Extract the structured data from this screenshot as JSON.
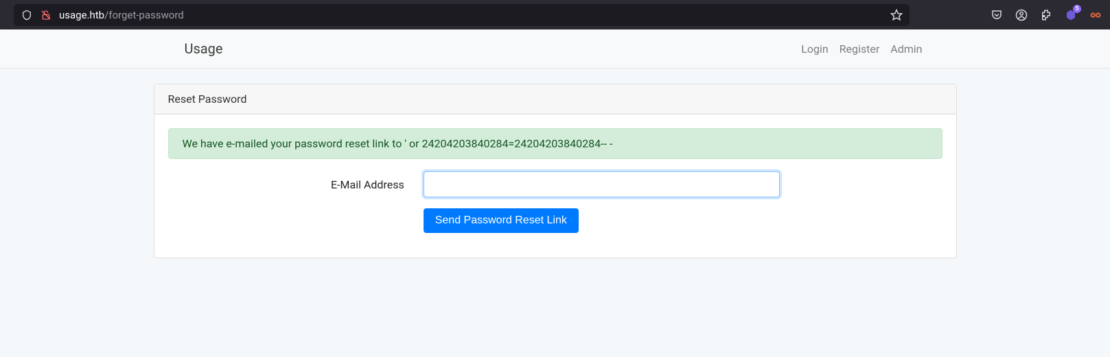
{
  "browser": {
    "url_domain": "usage.htb",
    "url_path": "/forget-password",
    "badge_count": "5"
  },
  "navbar": {
    "brand": "Usage",
    "links": {
      "login": "Login",
      "register": "Register",
      "admin": "Admin"
    }
  },
  "card": {
    "header": "Reset Password",
    "alert": "We have e-mailed your password reset link to ' or 24204203840284=24204203840284-- -",
    "email_label": "E-Mail Address",
    "email_value": "",
    "submit_label": "Send Password Reset Link"
  }
}
